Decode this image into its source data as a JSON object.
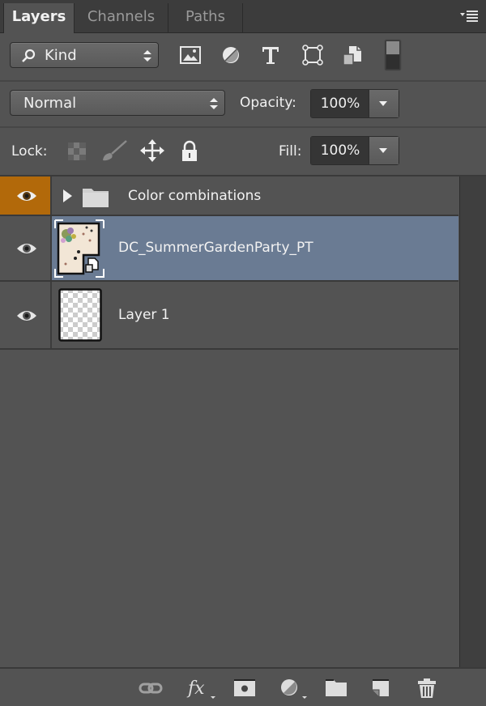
{
  "tabs": [
    {
      "label": "Layers",
      "active": true
    },
    {
      "label": "Channels",
      "active": false
    },
    {
      "label": "Paths",
      "active": false
    }
  ],
  "filter": {
    "kind_label": "Kind",
    "icons": [
      "pixel-layer-filter-icon",
      "adjustment-layer-filter-icon",
      "type-layer-filter-icon",
      "shape-layer-filter-icon",
      "smart-object-filter-icon",
      "filter-toggle-switch"
    ]
  },
  "blend": {
    "mode": "Normal",
    "opacity_label": "Opacity:",
    "opacity_value": "100%"
  },
  "lock": {
    "label": "Lock:",
    "fill_label": "Fill:",
    "fill_value": "100%"
  },
  "layers": [
    {
      "name": "Color combinations",
      "type": "group",
      "visible": true,
      "eye_highlight": "#b2690a"
    },
    {
      "name": "DC_SummerGardenParty_PT",
      "type": "smart-object",
      "visible": true,
      "selected": true
    },
    {
      "name": "Layer 1",
      "type": "pixel",
      "visible": true
    }
  ],
  "colors": {
    "panel_bg": "#535353",
    "selected_row": "#6a7b93",
    "group_eye_bg": "#b2690a"
  },
  "bottom_icons": [
    "link-layers-icon",
    "fx-icon",
    "add-mask-icon",
    "adjustment-layer-icon",
    "new-group-icon",
    "new-layer-icon",
    "delete-layer-icon"
  ]
}
